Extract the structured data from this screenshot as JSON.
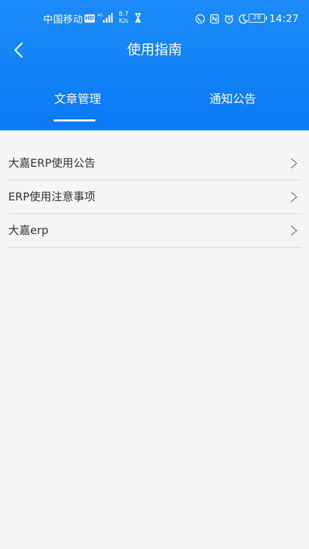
{
  "status_bar": {
    "carrier": "中国移动",
    "hd": "HD",
    "network": "4G",
    "speed_value": "8.7",
    "speed_unit": "K/s",
    "battery": "29",
    "time": "14:27"
  },
  "header": {
    "title": "使用指南"
  },
  "tabs": [
    {
      "label": "文章管理",
      "active": true
    },
    {
      "label": "通知公告",
      "active": false
    }
  ],
  "list": [
    {
      "label": "大嘉ERP使用公告"
    },
    {
      "label": "ERP使用注意事项"
    },
    {
      "label": "大嘉erp"
    }
  ],
  "colors": {
    "header_top": "#1c8bf8",
    "header_bottom": "#0a7af5",
    "background": "#f5f5f5",
    "divider": "#d8d8d8"
  }
}
